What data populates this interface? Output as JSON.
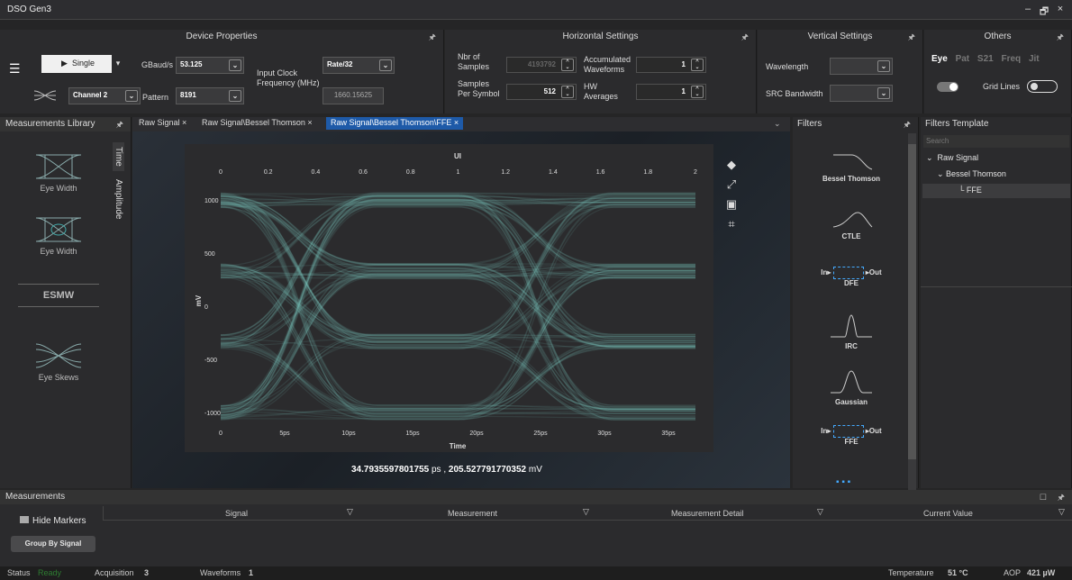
{
  "app": {
    "title": "DSO Gen3",
    "win_min": "–",
    "win_max": "🗗",
    "win_close": "×"
  },
  "device": {
    "header": "Device Properties",
    "mode": "Single",
    "gbaud_label": "GBaud/s",
    "gbaud_value": "53.125",
    "channel": "Channel 2",
    "pattern_label": "Pattern",
    "pattern_value": "8191",
    "clock_label": "Input Clock Frequency (MHz)",
    "rate": "Rate/32",
    "clock_value": "1660.15625"
  },
  "horizontal": {
    "header": "Horizontal Settings",
    "nbr_label": "Nbr of Samples",
    "nbr_value": "4193792",
    "sps_label": "Samples Per Symbol",
    "sps_value": "512",
    "acc_label": "Accumulated Waveforms",
    "acc_value": "1",
    "hw_label": "HW Averages",
    "hw_value": "1"
  },
  "vertical": {
    "header": "Vertical Settings",
    "wavelength_label": "Wavelength",
    "src_label": "SRC Bandwidth"
  },
  "others": {
    "header": "Others",
    "tabs": [
      "Eye",
      "Pat",
      "S21",
      "Freq",
      "Jit"
    ],
    "grid_label": "Grid Lines"
  },
  "library": {
    "header": "Measurements Library",
    "side_tabs": [
      "Time",
      "Amplitude"
    ],
    "items": [
      "Eye Width",
      "Eye Width",
      "ESMW",
      "Eye Skews"
    ]
  },
  "tabs": [
    "Raw Signal ×",
    "Raw Signal\\Bessel Thomson ×",
    "Raw Signal\\Bessel Thomson\\FFE ×"
  ],
  "plot": {
    "ui_label": "UI",
    "ui_ticks": [
      "0",
      "0.2",
      "0.4",
      "0.6",
      "0.8",
      "1",
      "1.2",
      "1.4",
      "1.6",
      "1.8",
      "2"
    ],
    "y_label": "mV",
    "y_ticks": [
      "1000",
      "500",
      "0",
      "-500",
      "-1000"
    ],
    "time_ticks": [
      "0",
      "5ps",
      "10ps",
      "15ps",
      "20ps",
      "25ps",
      "30ps",
      "35ps"
    ],
    "time_label": "Time",
    "cursor_x": "34.7935597801755",
    "cursor_x_unit": "ps ,",
    "cursor_y": "205.527791770352",
    "cursor_y_unit": "mV"
  },
  "filters": {
    "header": "Filters",
    "items": [
      "Bessel Thomson",
      "CTLE",
      "DFE",
      "IRC",
      "Gaussian",
      "FFE"
    ],
    "in": "In",
    "out": "Out"
  },
  "template": {
    "header": "Filters Template",
    "search_placeholder": "Search",
    "tree": [
      "Raw Signal",
      "Bessel Thomson",
      "FFE"
    ]
  },
  "measurements": {
    "header": "Measurements",
    "hide_markers": "Hide Markers",
    "group_by": "Group By Signal",
    "columns": [
      "Signal",
      "Measurement",
      "Measurement Detail",
      "Current Value"
    ]
  },
  "status": {
    "status_label": "Status",
    "status_value": "Ready",
    "acq_label": "Acquisition",
    "acq_value": "3",
    "wf_label": "Waveforms",
    "wf_value": "1",
    "temp_label": "Temperature",
    "temp_value": "51 °C",
    "aop_label": "AOP",
    "aop_value": "421 µW"
  }
}
